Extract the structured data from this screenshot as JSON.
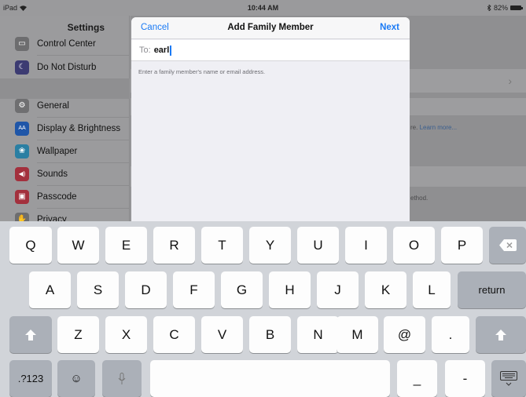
{
  "status_bar": {
    "carrier": "iPad",
    "time": "10:44 AM",
    "battery": "82%"
  },
  "settings": {
    "title": "Settings",
    "items": [
      {
        "label": "Control Center",
        "icon": "control-center-icon",
        "color": "#6d6d6f"
      },
      {
        "label": "Do Not Disturb",
        "icon": "moon-icon",
        "color": "#3c3b72"
      },
      {
        "label": "General",
        "icon": "gear-icon",
        "color": "#6f6f71"
      },
      {
        "label": "Display & Brightness",
        "icon": "display-icon",
        "color": "#1f56a8"
      },
      {
        "label": "Wallpaper",
        "icon": "wallpaper-icon",
        "color": "#2a7fa3"
      },
      {
        "label": "Sounds",
        "icon": "speaker-icon",
        "color": "#a3303d"
      },
      {
        "label": "Passcode",
        "icon": "lock-icon",
        "color": "#a3303d"
      },
      {
        "label": "Privacy",
        "icon": "hand-icon",
        "color": "#6d6d6f"
      }
    ]
  },
  "detail": {
    "note1_prefix": "re.",
    "note1_link": "Learn more...",
    "note2": "ethod."
  },
  "sheet": {
    "cancel": "Cancel",
    "title": "Add Family Member",
    "next": "Next",
    "to_label": "To:",
    "to_value": "earl",
    "hint": "Enter a family member's name or email address."
  },
  "keyboard": {
    "row1": [
      "Q",
      "W",
      "E",
      "R",
      "T",
      "Y",
      "U",
      "I",
      "O",
      "P"
    ],
    "row2": [
      "A",
      "S",
      "D",
      "F",
      "G",
      "H",
      "J",
      "K",
      "L"
    ],
    "row3": [
      "Z",
      "X",
      "C",
      "V",
      "B",
      "N",
      "M",
      "@",
      "."
    ],
    "return": "return",
    "numbers": ".?123",
    "underscore": "_",
    "dash": "-"
  },
  "colors": {
    "accent": "#1a7af5"
  }
}
